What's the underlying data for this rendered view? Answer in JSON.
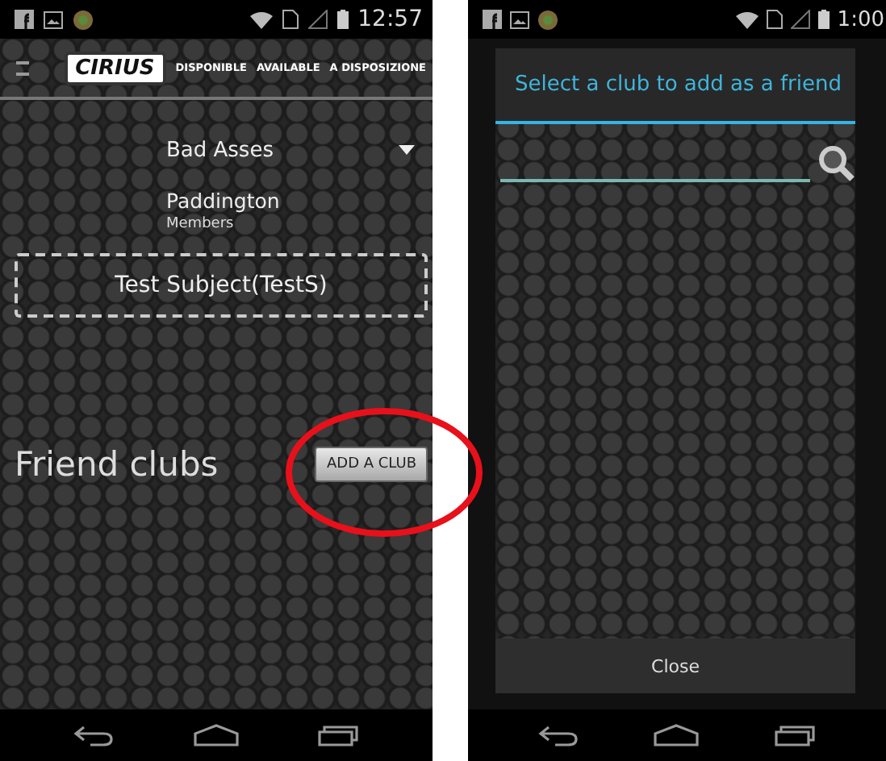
{
  "left_screen": {
    "status_bar": {
      "time": "12:57"
    },
    "app_header": {
      "logo": "CIRIUS",
      "banners": [
        "DISPONIBLE",
        "AVAILABLE",
        "A DISPOSIZIONE"
      ]
    },
    "club_dropdown": {
      "value": "Bad Asses"
    },
    "location": "Paddington",
    "members_label": "Members",
    "member": "Test Subject(TestS)",
    "friend_clubs": {
      "title": "Friend clubs",
      "add_button": "ADD A CLUB"
    }
  },
  "right_screen": {
    "status_bar": {
      "time": "1:00"
    },
    "dialog": {
      "title": "Select a club to add as a friend",
      "close_button": "Close"
    }
  }
}
